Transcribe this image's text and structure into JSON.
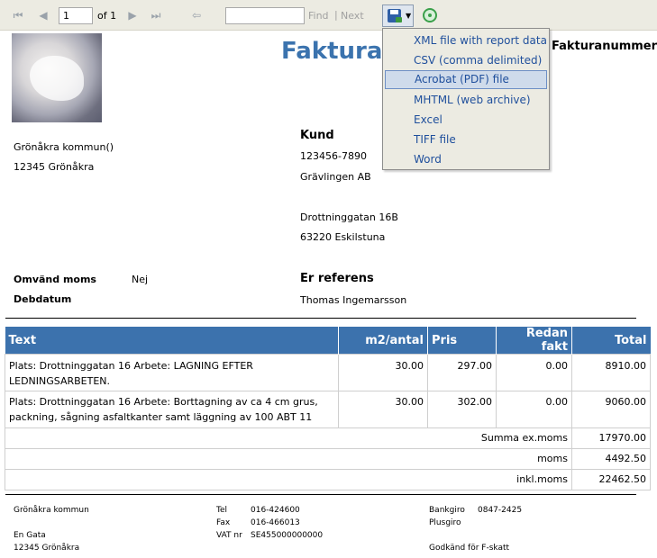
{
  "toolbar": {
    "page_value": "1",
    "page_of": "of 1",
    "find_label": "Find",
    "separator": "|",
    "next_label": "Next"
  },
  "export_menu": {
    "items": [
      "XML file with report data",
      "CSV (comma delimited)",
      "Acrobat (PDF) file",
      "MHTML (web archive)",
      "Excel",
      "TIFF file",
      "Word"
    ],
    "highlighted_index": 2
  },
  "report": {
    "title": "Faktura",
    "invoice_number_label": "Fakturanummer",
    "sender": {
      "name": "Grönåkra kommun()",
      "postal": "12345 Grönåkra"
    },
    "customer": {
      "heading": "Kund",
      "org_nr": "123456-7890",
      "name": "Grävlingen AB",
      "street": "Drottninggatan 16B",
      "postal": "63220  Eskilstuna"
    },
    "reverse_vat_label": "Omvänd moms",
    "reverse_vat_value": "Nej",
    "debit_date_label": "Debdatum",
    "reference_heading": "Er referens",
    "reference_name": "Thomas Ingemarsson"
  },
  "table": {
    "headers": [
      "Text",
      "m2/antal",
      "Pris",
      "Redan fakt",
      "Total"
    ],
    "rows": [
      {
        "text": "Plats: Drottninggatan 16 Arbete: LAGNING EFTER LEDNINGSARBETEN.",
        "qty": "30.00",
        "price": "297.00",
        "invoiced": "0.00",
        "total": "8910.00"
      },
      {
        "text": "Plats: Drottninggatan 16 Arbete: Borttagning av ca 4 cm grus, packning, sågning asfaltkanter samt läggning av 100 ABT 11",
        "qty": "30.00",
        "price": "302.00",
        "invoiced": "0.00",
        "total": "9060.00"
      }
    ],
    "summary": [
      {
        "label": "Summa ex.moms",
        "value": "17970.00"
      },
      {
        "label": "moms",
        "value": "4492.50"
      },
      {
        "label": "inkl.moms",
        "value": "22462.50"
      }
    ]
  },
  "footer": {
    "org_name": "Grönåkra kommun",
    "street": "En Gata",
    "postal": "12345 Grönåkra",
    "tel_label": "Tel",
    "tel_value": "016-424600",
    "fax_label": "Fax",
    "fax_value": "016-466013",
    "vat_label": "VAT nr",
    "vat_value": "SE455000000000",
    "bankgiro_label": "Bankgiro",
    "bankgiro_value": "0847-2425",
    "plusgiro_label": "Plusgiro",
    "f_tax_text": "Godkänd för F-skatt"
  },
  "colors": {
    "accent": "#3c72ad",
    "title": "#3b73ae",
    "menu_text": "#1f4f9c",
    "toolbar_bg": "#ecebe2"
  }
}
